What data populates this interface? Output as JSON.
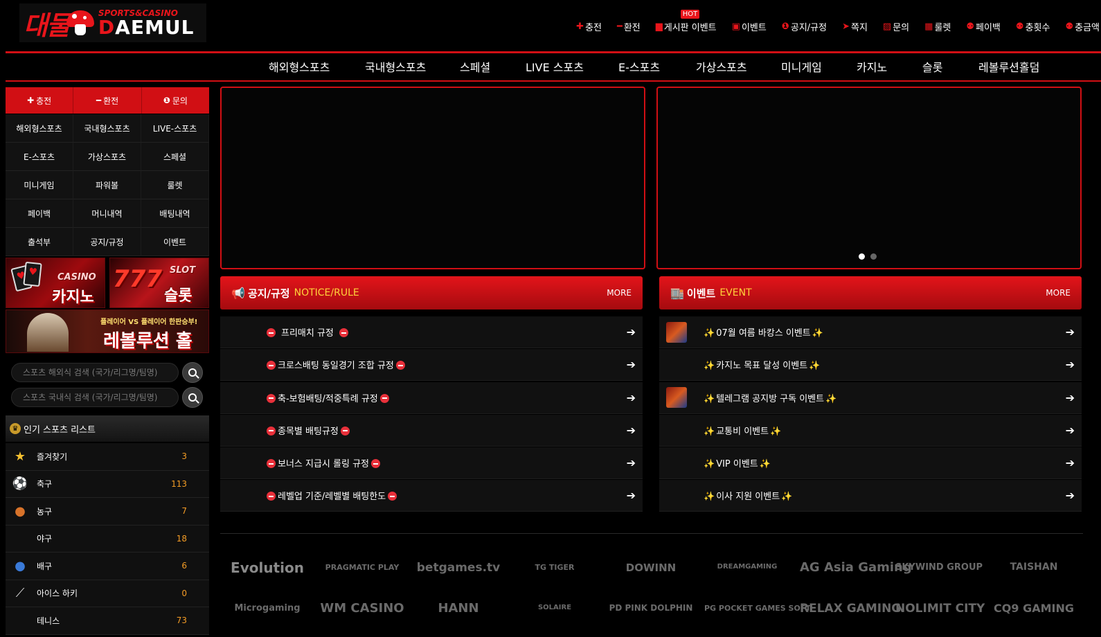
{
  "logo": {
    "kr": "대물",
    "en_top": "SPORTS&CASINO",
    "en_main_d": "D",
    "en_main_rest": "AEMUL"
  },
  "topnav": [
    {
      "icon": "plus-icon",
      "glyph": "✚",
      "label": "충전"
    },
    {
      "icon": "minus-icon",
      "glyph": "━",
      "label": "환전"
    },
    {
      "icon": "board-icon",
      "glyph": "▆",
      "label": "게시판 이벤트",
      "badge": "HOT"
    },
    {
      "icon": "calendar-icon",
      "glyph": "▣",
      "label": "이벤트"
    },
    {
      "icon": "info-icon",
      "glyph": "❶",
      "label": "공지/규정"
    },
    {
      "icon": "send-icon",
      "glyph": "➤",
      "label": "쪽지"
    },
    {
      "icon": "edit-icon",
      "glyph": "▨",
      "label": "문의"
    },
    {
      "icon": "gift-icon",
      "glyph": "▦",
      "label": "룰렛"
    },
    {
      "icon": "hand-icon",
      "glyph": "⚉",
      "label": "페이백"
    },
    {
      "icon": "hand-icon",
      "glyph": "⚉",
      "label": "충횟수"
    },
    {
      "icon": "hand-icon",
      "glyph": "⚉",
      "label": "충금액"
    }
  ],
  "mainnav": [
    "해외형스포츠",
    "국내형스포츠",
    "스페셜",
    "LIVE 스포츠",
    "E-스포츠",
    "가상스포츠",
    "미니게임",
    "카지노",
    "슬롯",
    "레볼루션홀덤"
  ],
  "quick": [
    {
      "glyph": "✚",
      "label": "충전"
    },
    {
      "glyph": "━",
      "label": "환전"
    },
    {
      "glyph": "❶",
      "label": "문의"
    }
  ],
  "menu": [
    "해외형스포츠",
    "국내형스포츠",
    "LIVE-스포츠",
    "E-스포츠",
    "가상스포츠",
    "스페셜",
    "미니게임",
    "파워볼",
    "룰렛",
    "페이백",
    "머니내역",
    "배팅내역",
    "출석부",
    "공지/규정",
    "이벤트"
  ],
  "banners": {
    "casino_en": "CASINO",
    "casino_kr": "카지노",
    "slot_en": "SLOT",
    "slot_kr": "슬롯",
    "slot_num": "777",
    "holdem_sub": "플레이어 VS 플레이어 한판승부!",
    "holdem_kr": "레볼루션 홀덤"
  },
  "search": [
    {
      "placeholder": "스포츠 해외식 검색 (국가/리그명/팀명)"
    },
    {
      "placeholder": "스포츠 국내식 검색 (국가/리그명/팀명)"
    }
  ],
  "popular": {
    "title": "인기 스포츠 리스트",
    "items": [
      {
        "icon": "star-icon",
        "glyph": "★",
        "color": "#f5c030",
        "name": "즐겨찾기",
        "count": "3"
      },
      {
        "icon": "soccer-icon",
        "glyph": "⚽",
        "color": "#ffffff",
        "name": "축구",
        "count": "113"
      },
      {
        "icon": "basketball-icon",
        "glyph": "●",
        "color": "#d8732a",
        "name": "농구",
        "count": "7"
      },
      {
        "icon": "baseball-icon",
        "glyph": "",
        "color": "#ffffff",
        "name": "야구",
        "count": "18"
      },
      {
        "icon": "volleyball-icon",
        "glyph": "●",
        "color": "#3a7ad8",
        "name": "배구",
        "count": "6"
      },
      {
        "icon": "hockey-icon",
        "glyph": "⟋",
        "color": "#dddddd",
        "name": "아이스 하키",
        "count": "0"
      },
      {
        "icon": "tennis-icon",
        "glyph": "",
        "color": "#ffffff",
        "name": "테니스",
        "count": "73"
      }
    ]
  },
  "notice": {
    "title_kr": "공지/규정",
    "title_en": "NOTICE/RULE",
    "more": "MORE",
    "items": [
      "프리매치 규정",
      "크로스배팅 동일경기 조합 규정",
      "축-보험배팅/적중특례 규정",
      "종목별 배팅규정",
      "보너스 지급시 롤링 규정",
      "레벨업 기준/레벨별 배팅한도"
    ]
  },
  "event": {
    "title_kr": "이벤트",
    "title_en": "EVENT",
    "more": "MORE",
    "items": [
      {
        "label": "07월 여름 바캉스 이벤트",
        "thumb": true
      },
      {
        "label": "카지노 목표 달성 이벤트",
        "thumb": false
      },
      {
        "label": "텔레그램 공지방 구독 이벤트",
        "thumb": true
      },
      {
        "label": "교통비 이벤트",
        "thumb": false
      },
      {
        "label": "VIP 이벤트",
        "thumb": false
      },
      {
        "label": "이사 지원 이벤트",
        "thumb": false
      }
    ]
  },
  "slider": {
    "dots": 2,
    "active": 1
  },
  "providers_row1": [
    "Evolution",
    "PRAGMATIC PLAY",
    "betgames.tv",
    "TG TIGER",
    "DOWINN",
    "DREAMGAMING",
    "AG Asia Gaming",
    "SKYWIND GROUP",
    "TAISHAN"
  ],
  "providers_row2": [
    "Microgaming",
    "WM CASINO",
    "HANN",
    "SOLAIRE",
    "PD PINK DOLPHIN",
    "PG POCKET GAMES SOFT",
    "RELAX GAMING",
    "NOLIMIT CITY",
    "CQ9 GAMING"
  ],
  "colors": {
    "accent": "#d10f14",
    "count": "#f39c25",
    "event_en": "#ffd23a"
  }
}
